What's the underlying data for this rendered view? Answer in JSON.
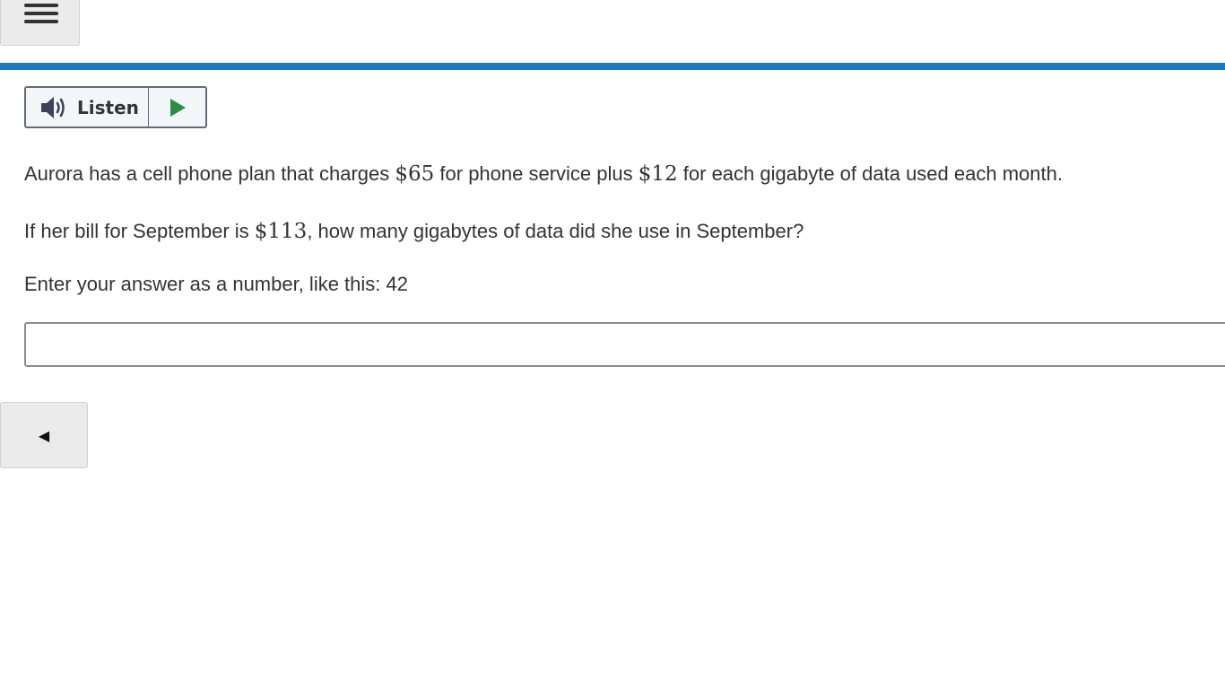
{
  "header": {
    "menu_icon": "hamburger-icon",
    "rule_color": "#1f78b4"
  },
  "listen": {
    "label": "Listen",
    "speaker_icon": "speaker-icon",
    "play_icon": "play-icon",
    "play_color": "#2e8b47"
  },
  "question": {
    "line1_before": "Aurora has a cell phone plan that charges ",
    "line1_math1": "$65",
    "line1_mid": " for phone service plus ",
    "line1_math2": "$12",
    "line1_after": " for each gigabyte of data used each month.",
    "line2_before": "If her bill for September is ",
    "line2_math": "$113",
    "line2_after": ", how many gigabytes of data did she use in September?",
    "instruction": "Enter your answer as a number, like this: 42"
  },
  "answer": {
    "value": "",
    "placeholder": ""
  },
  "navigation": {
    "back_glyph": "◀",
    "back_icon": "left-triangle-icon"
  }
}
